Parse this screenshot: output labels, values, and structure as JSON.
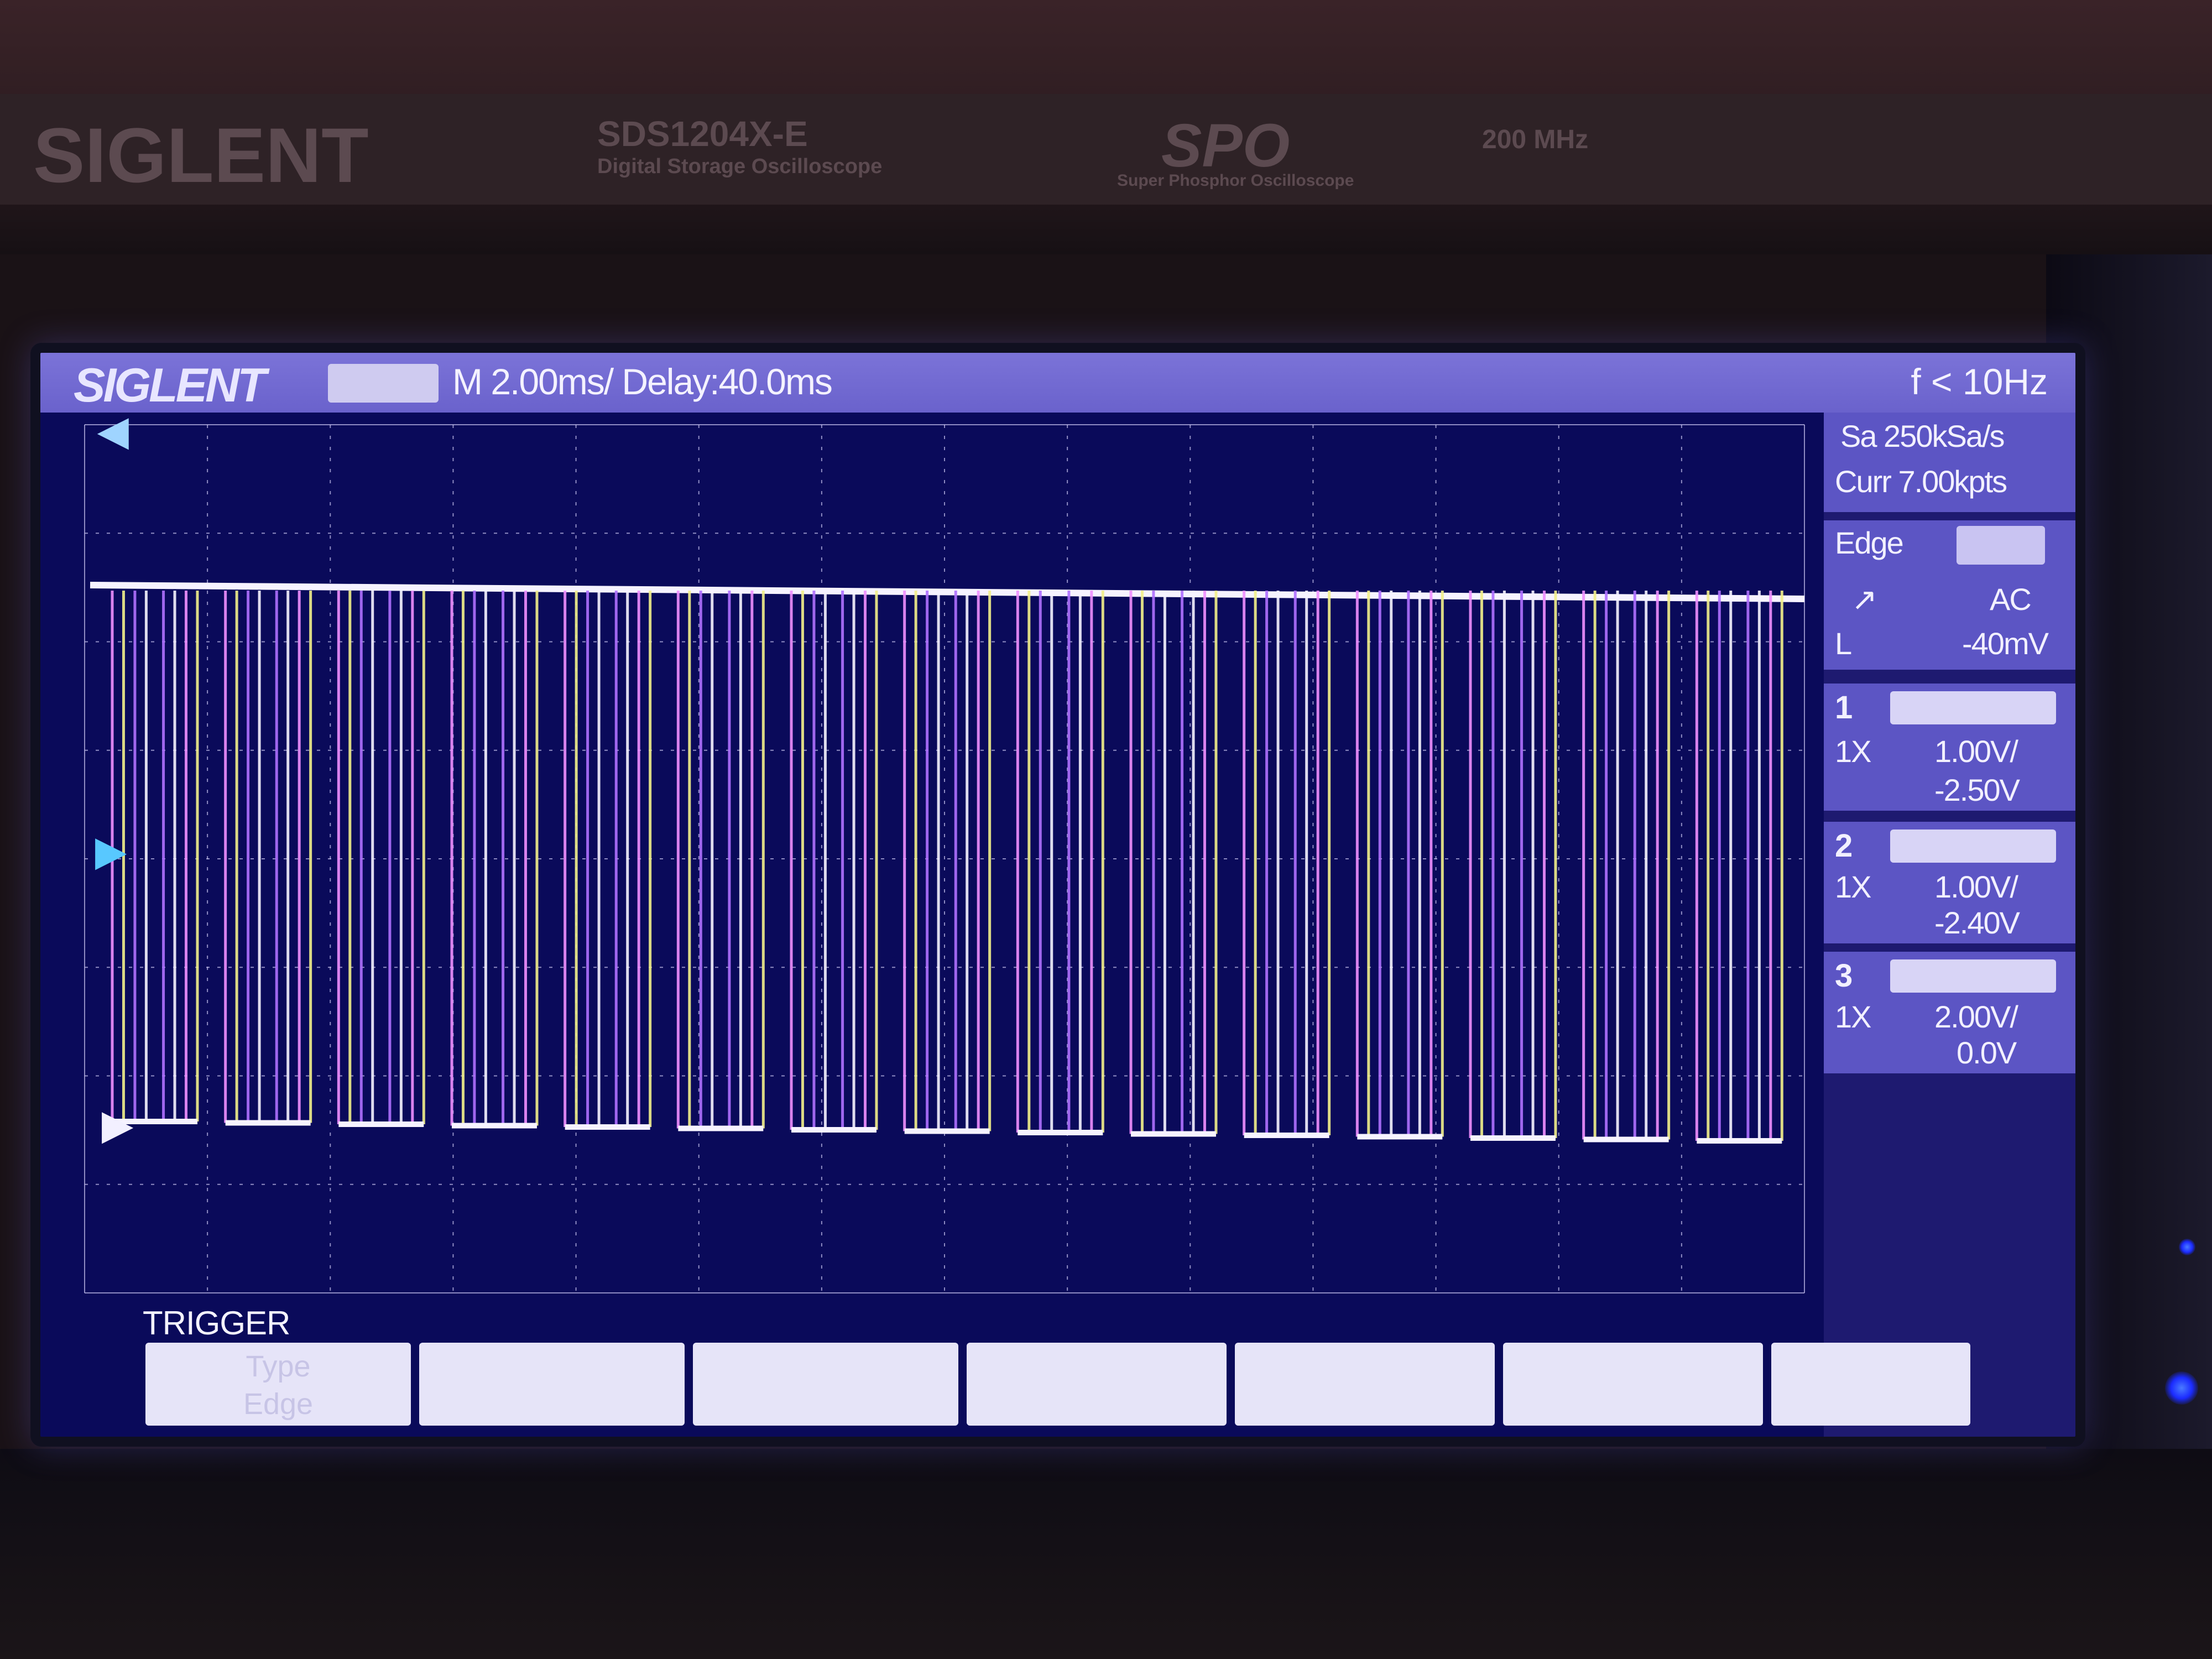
{
  "device": {
    "brand": "SIGLENT",
    "model": "SDS1204X-E",
    "subtitle": "Digital Storage Oscilloscope",
    "spo_logo": "SPO",
    "spo_subtitle": "Super Phosphor Oscilloscope",
    "bandwidth": "200 MHz"
  },
  "header": {
    "logo": "SIGLENT",
    "timebase": "M 2.00ms/ Delay:40.0ms",
    "trigger_freq": "f < 10Hz"
  },
  "acquisition": {
    "sample_rate": "Sa 250kSa/s",
    "curr_points": "Curr 7.00kpts"
  },
  "trigger": {
    "type_label": "Edge",
    "coupling": "AC",
    "level_prefix": "L",
    "level": "-40mV"
  },
  "channels": [
    {
      "number": "1",
      "probe": "1X",
      "scale": "1.00V/",
      "offset": "-2.50V"
    },
    {
      "number": "2",
      "probe": "1X",
      "scale": "1.00V/",
      "offset": "-2.40V"
    },
    {
      "number": "3",
      "probe": "1X",
      "scale": "2.00V/",
      "offset": "0.0V"
    }
  ],
  "menu": {
    "title": "TRIGGER",
    "softkeys": [
      {
        "line1": "Type",
        "line2": "Edge"
      },
      {
        "line1": "",
        "line2": ""
      },
      {
        "line1": "",
        "line2": ""
      },
      {
        "line1": "",
        "line2": ""
      },
      {
        "line1": "",
        "line2": ""
      },
      {
        "line1": "",
        "line2": ""
      },
      {
        "line1": "",
        "line2": ""
      }
    ]
  },
  "colors": {
    "screen_bg": "#0a0a5a",
    "header_bar": "#7b73d8",
    "trace_white": "#f6f3ff",
    "trace_yellow": "#f2f08a",
    "trace_pink": "#f090ff",
    "trace_violet": "#b070ff"
  },
  "icons": {
    "trigger_position_marker": "left-triangle-icon",
    "channel_ground_marker": "right-arrow-icon",
    "trigger_slope": "rising-edge-icon"
  },
  "waveform": {
    "channels": [
      "1",
      "2",
      "3"
    ],
    "high_state": "high",
    "low_state": "low",
    "pulse_count": 15
  }
}
